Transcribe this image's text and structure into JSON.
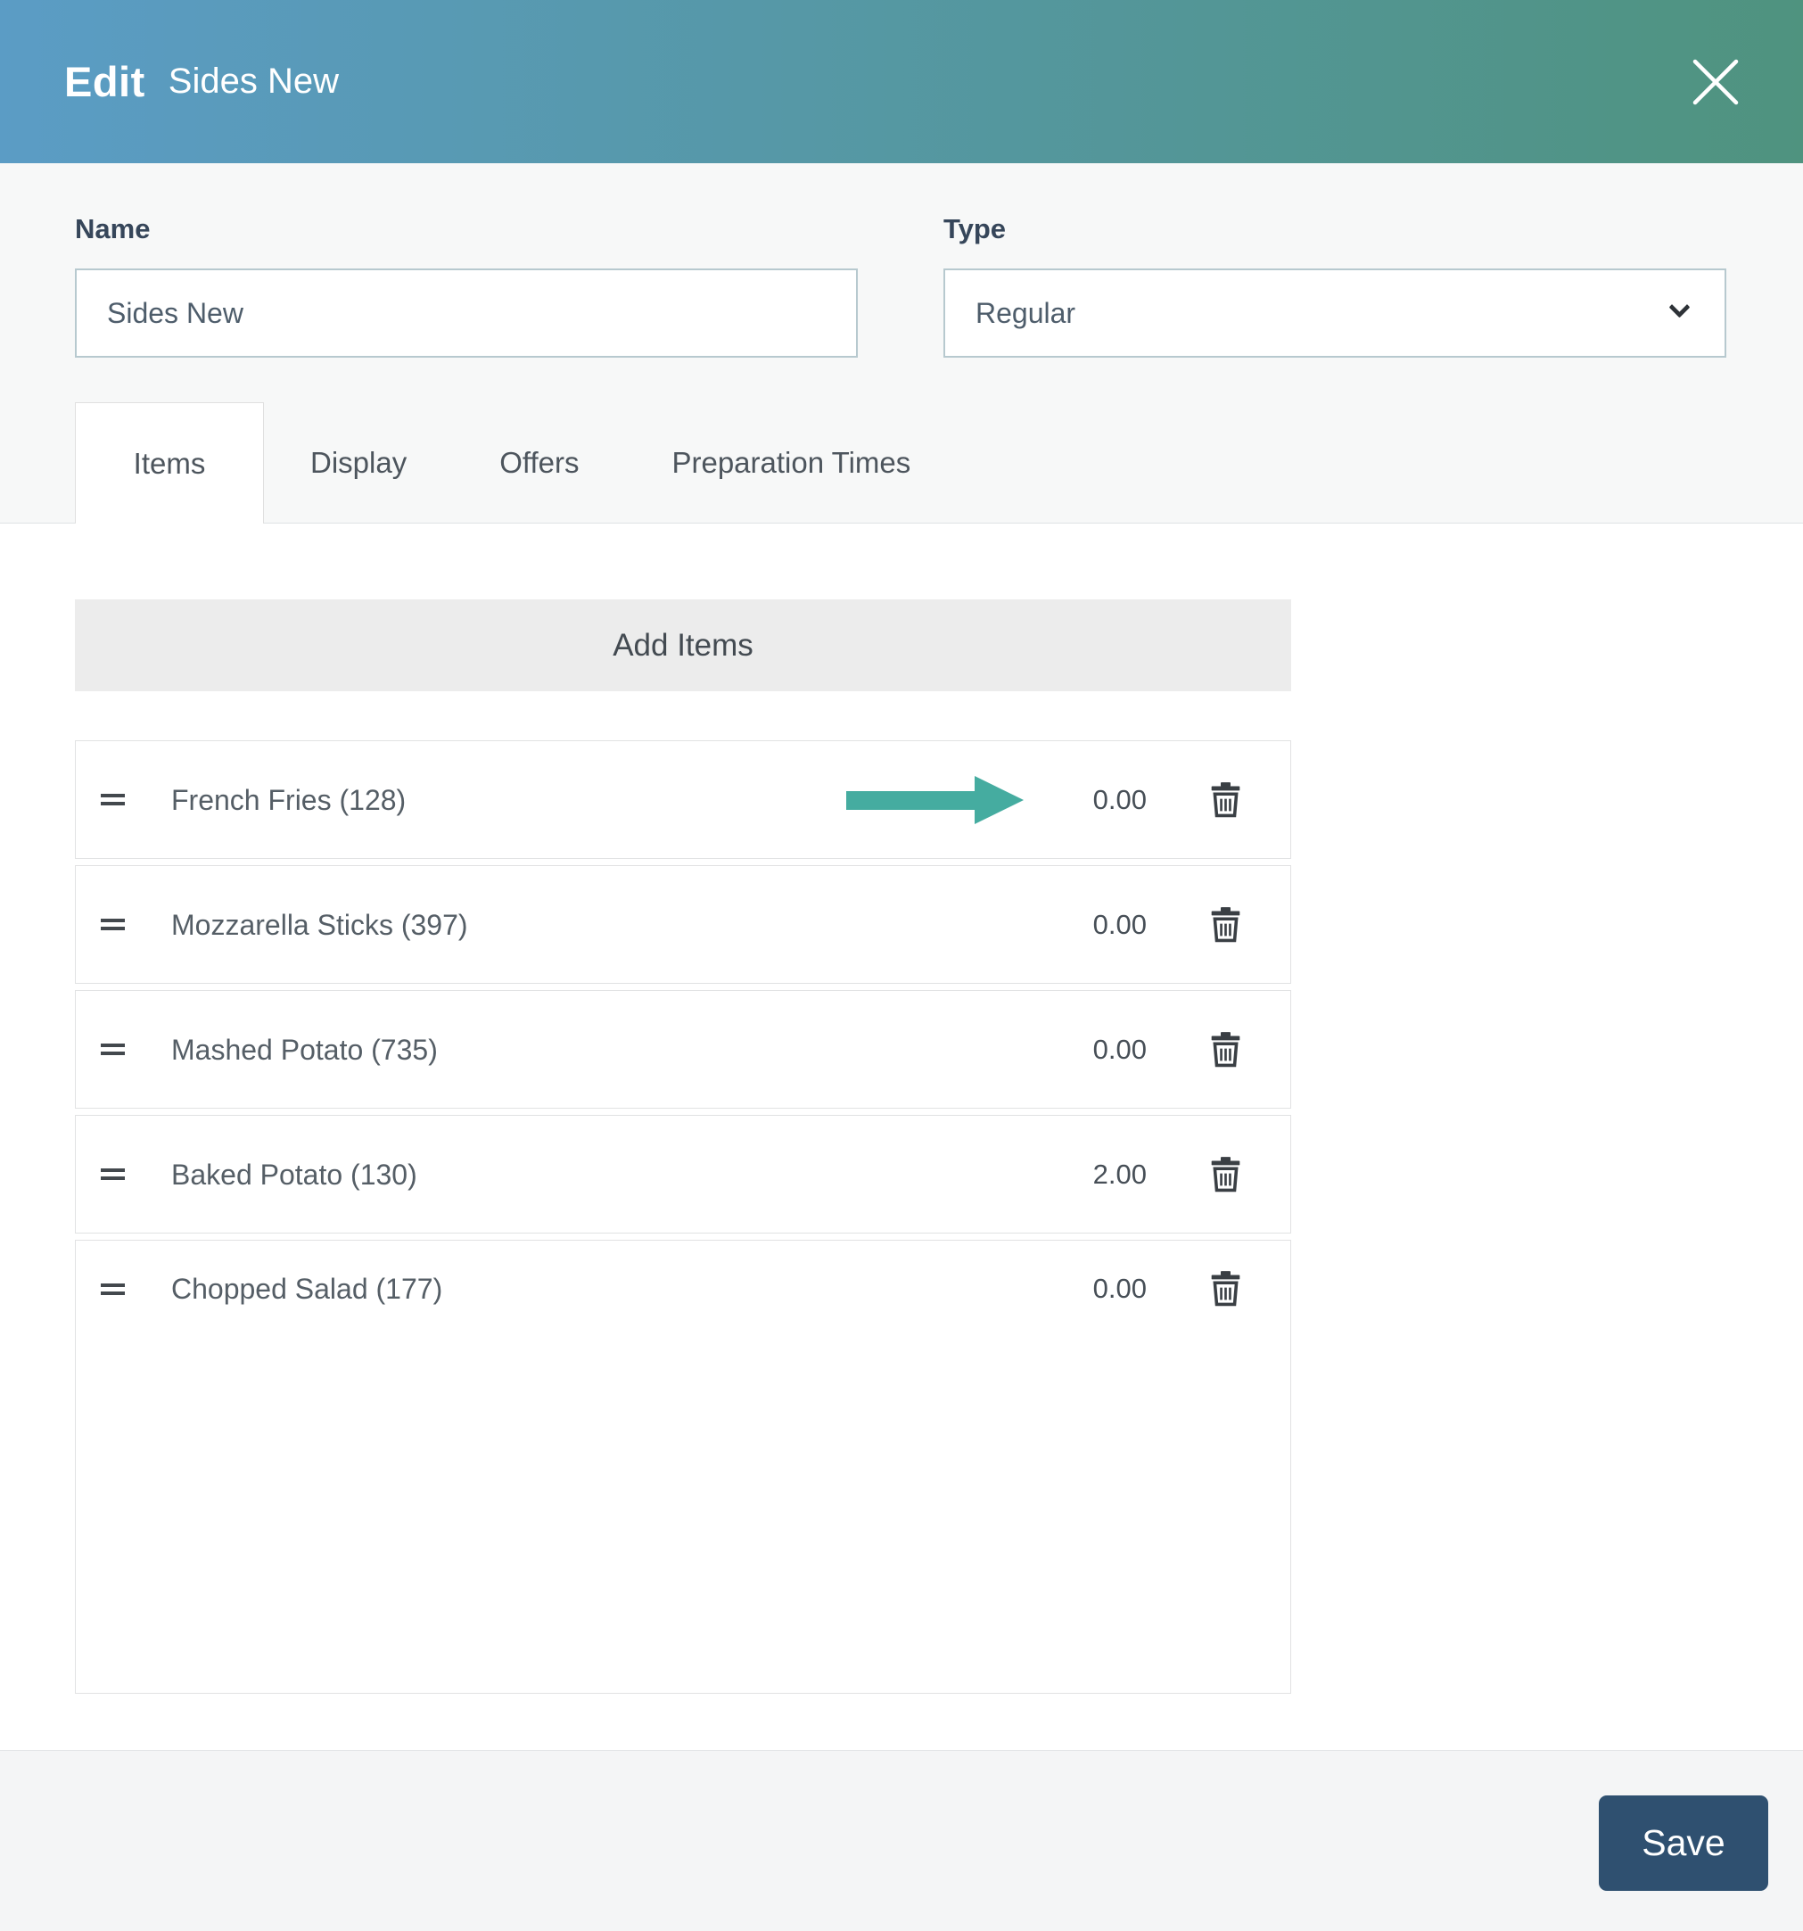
{
  "header": {
    "title_prefix": "Edit",
    "title_name": "Sides New"
  },
  "form": {
    "name": {
      "label": "Name",
      "value": "Sides New"
    },
    "type": {
      "label": "Type",
      "value": "Regular"
    }
  },
  "tabs": [
    {
      "label": "Items",
      "active": true
    },
    {
      "label": "Display",
      "active": false
    },
    {
      "label": "Offers",
      "active": false
    },
    {
      "label": "Preparation Times",
      "active": false
    }
  ],
  "add_items_label": "Add Items",
  "items": [
    {
      "label": "French Fries  (128)",
      "price": "0.00",
      "annotated": true
    },
    {
      "label": "Mozzarella Sticks  (397)",
      "price": "0.00",
      "annotated": false
    },
    {
      "label": "Mashed Potato  (735)",
      "price": "0.00",
      "annotated": false
    },
    {
      "label": "Baked Potato  (130)",
      "price": "2.00",
      "annotated": false
    },
    {
      "label": "Chopped Salad  (177)",
      "price": "0.00",
      "annotated": false
    }
  ],
  "footer": {
    "save_label": "Save"
  },
  "colors": {
    "header_gradient_start": "#5b9cc5",
    "header_gradient_end": "#4f937f",
    "annotation_arrow": "#45aca0",
    "save_button": "#2f5070",
    "label_text": "#36465a"
  }
}
